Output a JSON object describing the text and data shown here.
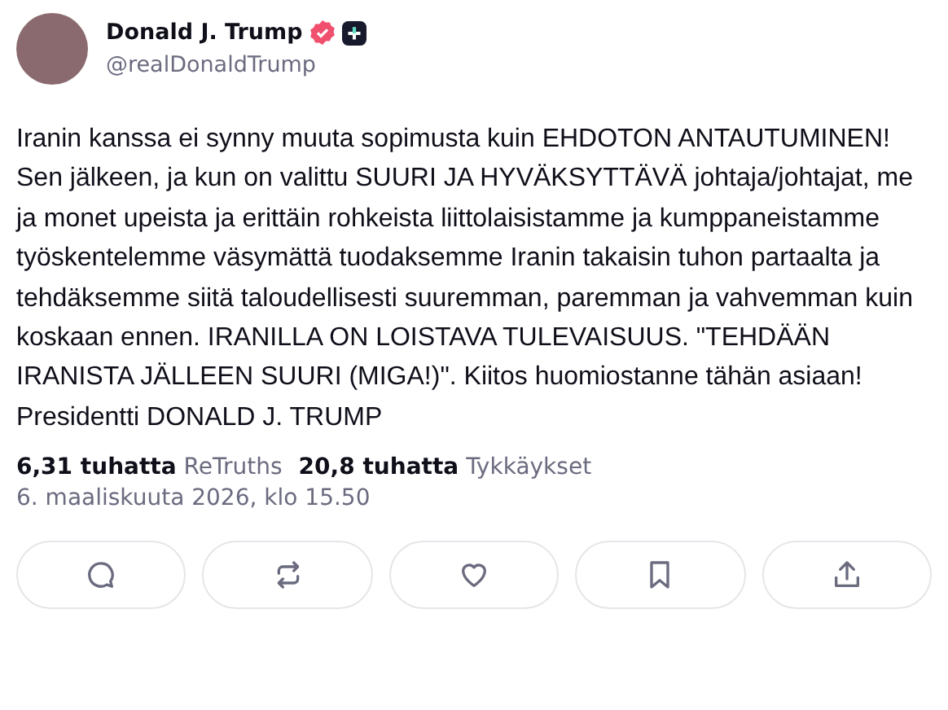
{
  "author": {
    "name": "Donald J. Trump",
    "handle": "@realDonaldTrump",
    "verified": true,
    "badge_plus": true
  },
  "post": {
    "text": "Iranin kanssa ei synny muuta sopimusta kuin EHDOTON ANTAUTUMINEN! Sen jälkeen, ja kun on valittu SUURI JA HYVÄKSYTTÄVÄ johtaja/johtajat, me ja monet upeista ja erittäin rohkeista liittolaisistamme ja kumppaneistamme työskentelemme väsymättä tuodaksemme Iranin takaisin tuhon partaalta ja tehdäksemme siitä taloudellisesti suuremman, paremman ja vahvemman kuin koskaan ennen. IRANILLA ON LOISTAVA TULEVAISUUS. \"TEHDÄÄN IRANISTA JÄLLEEN SUURI (MIGA!)\". Kiitos huomiostanne tähän asiaan! Presidentti DONALD J. TRUMP"
  },
  "stats": [
    {
      "count": "6,31 tuhatta",
      "label": "ReTruths"
    },
    {
      "count": "20,8 tuhatta",
      "label": "Tykkäykset"
    }
  ],
  "timestamp": "6. maaliskuuta 2026, klo 15.50",
  "actions": [
    {
      "kind": "reply"
    },
    {
      "kind": "retruth"
    },
    {
      "kind": "like"
    },
    {
      "kind": "bookmark"
    },
    {
      "kind": "share"
    }
  ]
}
